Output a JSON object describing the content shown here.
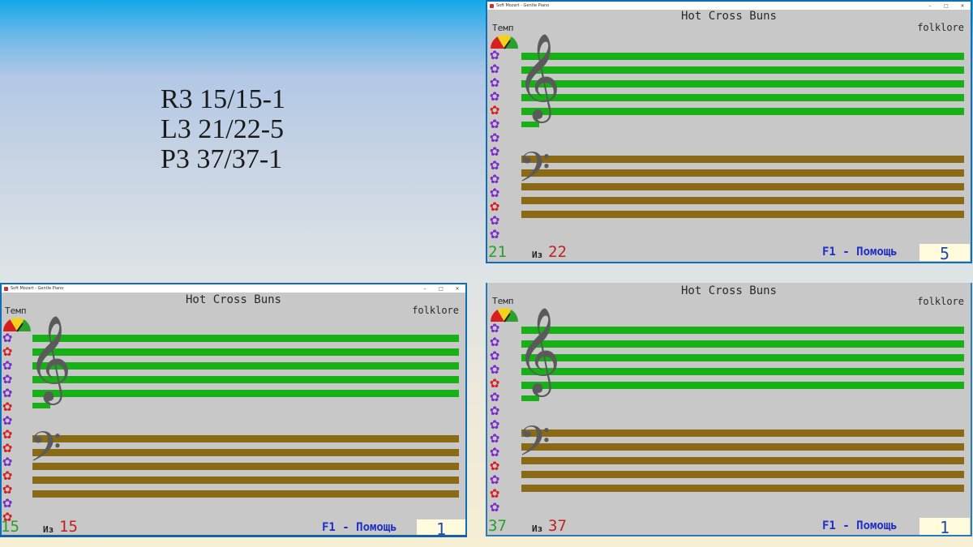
{
  "stats": [
    "R3 15/15-1",
    "L3 21/22-5",
    "P3 37/37-1"
  ],
  "app": {
    "window_title": "Soft Mozart - Gentle Piano",
    "minimize": "–",
    "maximize": "□",
    "close": "✕",
    "song_title": "Hot Cross Buns",
    "genre": "folklore",
    "tempo_label": "Темп",
    "of_label": "Из",
    "help_label": "F1 - Помощь"
  },
  "windows": {
    "top_right": {
      "current": "21",
      "total": "22",
      "score": "5"
    },
    "bottom_left": {
      "current": "15",
      "total": "15",
      "score": "1"
    },
    "bottom_right": {
      "current": "37",
      "total": "37",
      "score": "1"
    }
  },
  "icons": {
    "treble_clef": "𝄞",
    "bass_clef": "𝄢",
    "flower": "✿"
  },
  "colors": {
    "treble_staff": "#17b017",
    "bass_staff": "#8a6a14",
    "flower_purple": "#7a2cc8",
    "flower_red": "#d42020"
  }
}
